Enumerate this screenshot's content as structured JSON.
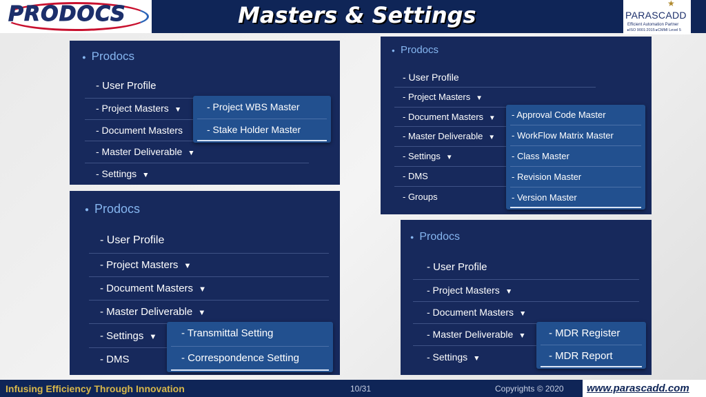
{
  "header": {
    "title": "Masters & Settings",
    "logo_left": "PRODOCS",
    "logo_right": {
      "brand": "PARASCADD",
      "tagline": "Efficient Automation Partner",
      "certs": "▸ISO 9001:2015 ▸CMMI Level 5"
    }
  },
  "panel1": {
    "brand": "Prodocs",
    "items": [
      "- User Profile",
      "-  Project Masters",
      "-  Document Masters",
      "-  Master Deliverable",
      "-  Settings"
    ],
    "dropdown": [
      "- Project WBS Master",
      "- Stake Holder Master"
    ]
  },
  "panel2": {
    "brand": "Prodocs",
    "items": [
      "- User Profile",
      "-  Project Masters",
      "-  Document Masters",
      "-  Master Deliverable",
      "-  Settings",
      "- DMS",
      "- Groups"
    ],
    "dropdown": [
      "- Approval Code Master",
      "- WorkFlow Matrix Master",
      "- Class Master",
      "- Revision Master",
      "- Version Master"
    ]
  },
  "panel3": {
    "brand": "Prodocs",
    "items": [
      "- User Profile",
      "-  Project Masters",
      "-  Document Masters",
      "-  Master Deliverable",
      "-  Settings",
      "- DMS"
    ],
    "dropdown": [
      "- Transmittal Setting",
      "- Correspondence Setting"
    ]
  },
  "panel4": {
    "brand": "Prodocs",
    "items": [
      "- User Profile",
      "-  Project Masters",
      "-  Document Masters",
      "-  Master Deliverable",
      "-  Settings"
    ],
    "dropdown": [
      "- MDR Register",
      "- MDR Report"
    ]
  },
  "icons": {
    "bullet": "bullet-dot",
    "caret": "caret-down"
  },
  "colors": {
    "panel_bg": "#17295c",
    "dropdown_bg": "#22508f",
    "brand_text": "#86b6f0",
    "header_bg": "#0f2557",
    "tagline": "#d9b84a"
  },
  "footer": {
    "tagline": "Infusing Efficiency Through Innovation",
    "page": "10/31",
    "copyright": "Copyrights © 2020",
    "website": "www.parascadd.com"
  }
}
